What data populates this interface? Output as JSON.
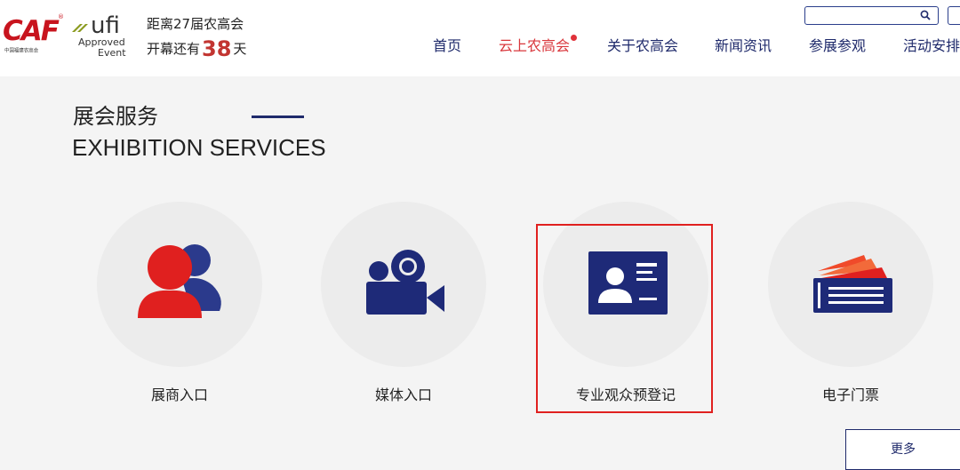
{
  "header": {
    "caf_logo_text": "CAF",
    "caf_logo_sub": "中国福建农高会",
    "ufi_logo_text": "ufi",
    "ufi_approved": "Approved",
    "ufi_event": "Event",
    "countdown_line1": "距离27届农高会",
    "countdown_prefix": "开幕还有",
    "countdown_days": "38",
    "countdown_suffix": "天",
    "search_value": ""
  },
  "nav": [
    {
      "label": "首页"
    },
    {
      "label": "云上农高会"
    },
    {
      "label": "关于农高会"
    },
    {
      "label": "新闻资讯"
    },
    {
      "label": "参展参观"
    },
    {
      "label": "活动安排"
    }
  ],
  "section": {
    "title_cn": "展会服务",
    "title_en": "EXHIBITION SERVICES"
  },
  "services": [
    {
      "label": "展商入口",
      "icon": "exhibitor-icon"
    },
    {
      "label": "媒体入口",
      "icon": "video-camera-icon"
    },
    {
      "label": "专业观众预登记",
      "icon": "id-card-icon"
    },
    {
      "label": "电子门票",
      "icon": "ticket-icon"
    }
  ],
  "more_label": "更多",
  "colors": {
    "brand_navy": "#1f2a6b",
    "brand_red": "#d9373c",
    "icon_navy": "#1e2a78",
    "icon_red": "#e0201f",
    "page_bg": "#f4f4f4",
    "circle_bg": "#ececec"
  }
}
